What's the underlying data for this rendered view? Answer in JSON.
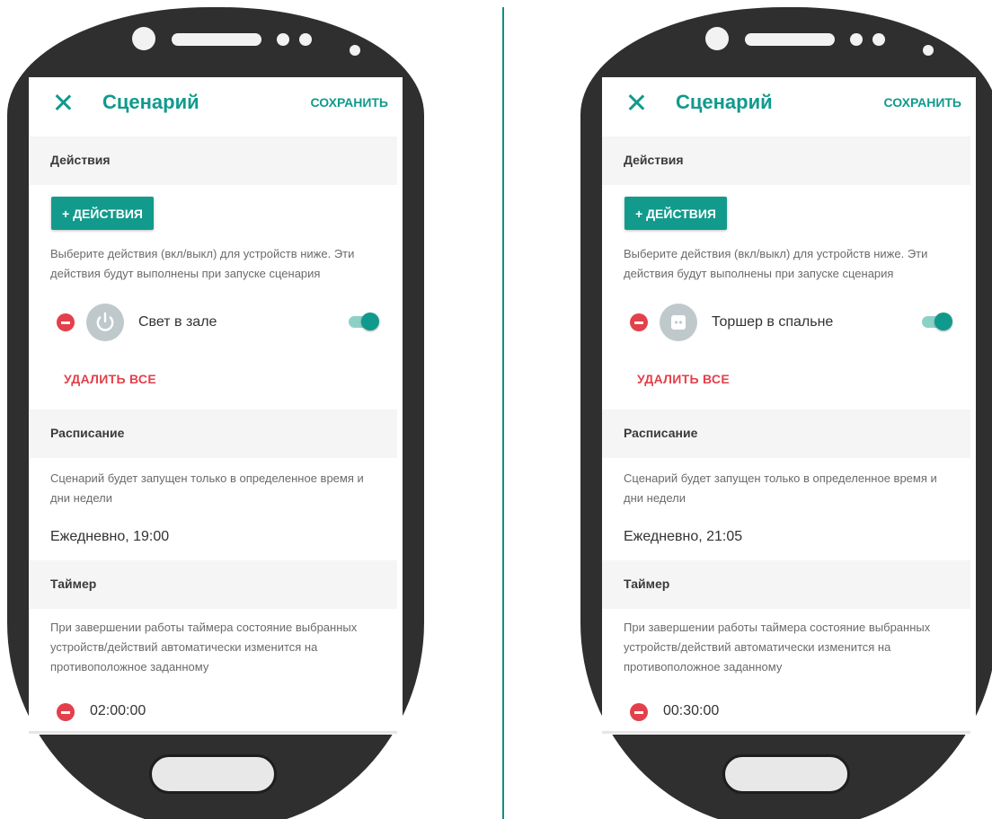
{
  "screens": [
    {
      "header": {
        "title": "Сценарий",
        "save_label": "СОХРАНИТЬ"
      },
      "actions": {
        "section_title": "Действия",
        "add_label": "+ ДЕЙСТВИЯ",
        "description": "Выберите действия (вкл/выкл) для устройств ниже. Эти действия будут выполнены при запуске сценария",
        "device": {
          "name": "Свет в зале",
          "icon": "power-icon",
          "enabled": true
        },
        "delete_all_label": "УДАЛИТЬ ВСЕ"
      },
      "schedule": {
        "section_title": "Расписание",
        "description": "Сценарий будет запущен только в определенное время и дни недели",
        "value": "Ежедневно, 19:00"
      },
      "timer": {
        "section_title": "Таймер",
        "description": "При завершении работы таймера состояние выбранных устройств/действий автоматически изменится на противоположное заданному",
        "value": "02:00:00"
      }
    },
    {
      "header": {
        "title": "Сценарий",
        "save_label": "СОХРАНИТЬ"
      },
      "actions": {
        "section_title": "Действия",
        "add_label": "+ ДЕЙСТВИЯ",
        "description": "Выберите действия (вкл/выкл) для устройств ниже. Эти действия будут выполнены при запуске сценария",
        "device": {
          "name": "Торшер в спальне",
          "icon": "socket-icon",
          "enabled": true
        },
        "delete_all_label": "УДАЛИТЬ ВСЕ"
      },
      "schedule": {
        "section_title": "Расписание",
        "description": "Сценарий будет запущен только в определенное время и дни недели",
        "value": "Ежедневно, 21:05"
      },
      "timer": {
        "section_title": "Таймер",
        "description": "При завершении работы таймера состояние выбранных устройств/действий автоматически изменится на противоположное заданному",
        "value": "00:30:00"
      }
    }
  ],
  "colors": {
    "accent": "#109a8d",
    "danger": "#e3404b",
    "phone_body": "#2f2f2f",
    "divider": "#0f8f86"
  }
}
